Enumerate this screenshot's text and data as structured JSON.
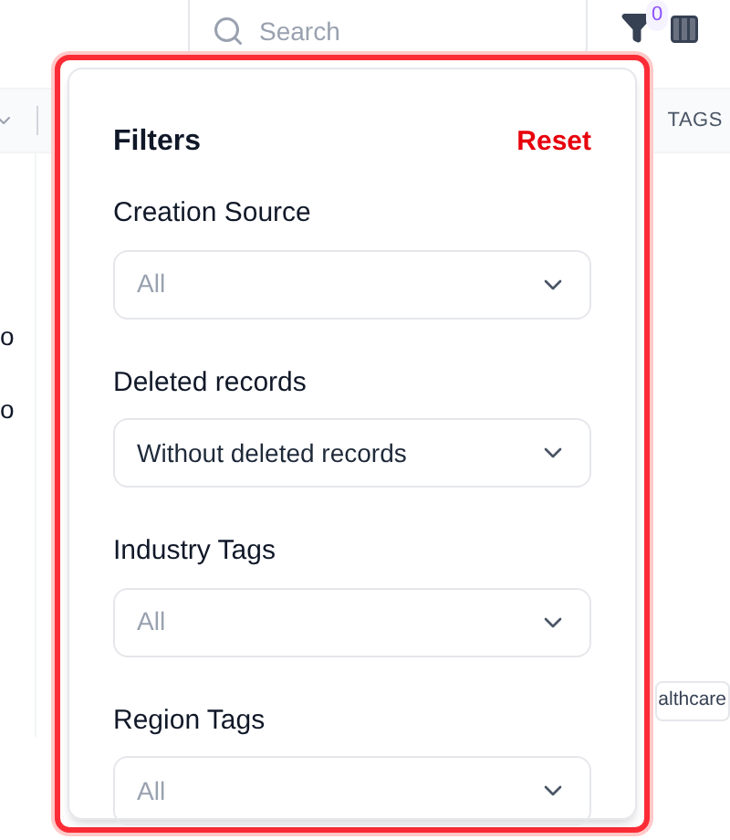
{
  "toolbar": {
    "search": {
      "placeholder": "Search"
    },
    "filter_badge": "0"
  },
  "table": {
    "column_header": "TAGS",
    "rows": [
      {
        "cell": ""
      },
      {
        "cell": ""
      },
      {
        "cell": "o"
      },
      {
        "cell": "o"
      },
      {
        "cell": ""
      },
      {
        "cell": ""
      },
      {
        "cell": ""
      },
      {
        "cell": "",
        "tag": "althcare"
      }
    ]
  },
  "filters": {
    "title": "Filters",
    "reset": "Reset",
    "fields": [
      {
        "label": "Creation Source",
        "placeholder": "All"
      },
      {
        "label": "Deleted records",
        "value": "Without deleted records"
      },
      {
        "label": "Industry Tags",
        "placeholder": "All"
      },
      {
        "label": "Region Tags",
        "placeholder": "All"
      }
    ]
  }
}
